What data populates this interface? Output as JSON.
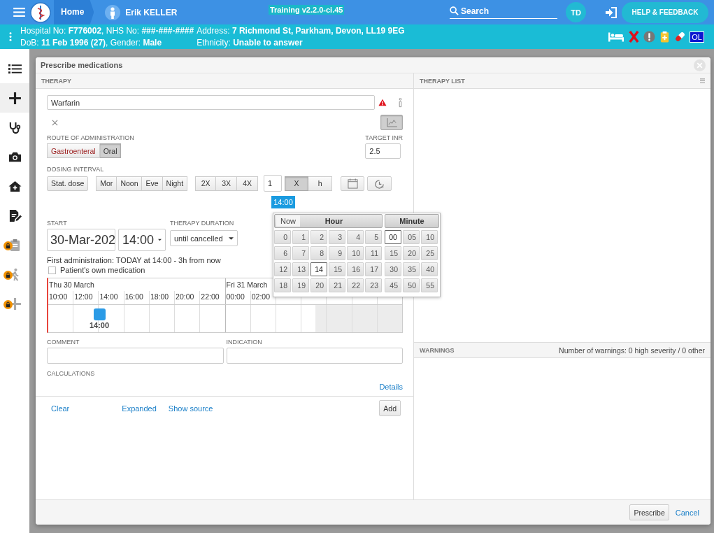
{
  "top_bar": {
    "home": "Home",
    "patient_name": "Erik KELLER",
    "version": "Training v2.2.0-ci.45",
    "search": {
      "placeholder": "Search"
    },
    "user_initials": "TD",
    "help_button": "HELP & FEEDBACK"
  },
  "patient_banner": {
    "lines": [
      "Hospital No: **F776002**, NHS No: **###-###-####**",
      "DoB: **11 Feb 1996 (27)**, Gender: **Male**"
    ],
    "address_lines": [
      "Address: **7 Richmond St, Parkham, Devon, LL19 9EG**",
      "Ethnicity: **Unable to answer**"
    ],
    "icons": [
      {
        "kind": "bed"
      },
      {
        "kind": "cross"
      },
      {
        "kind": "alert"
      },
      {
        "kind": "clipboard"
      },
      {
        "kind": "pill"
      },
      {
        "kind": "badge",
        "label": "OL"
      }
    ]
  },
  "sidebar": {
    "items": [
      {
        "kind": "list",
        "selected": false,
        "locked": false
      },
      {
        "kind": "plus",
        "selected": true,
        "locked": false
      },
      {
        "kind": "stethoscope",
        "selected": false,
        "locked": false
      },
      {
        "kind": "camera",
        "selected": false,
        "locked": false
      },
      {
        "kind": "house",
        "selected": false,
        "locked": false
      },
      {
        "kind": "document",
        "selected": false,
        "locked": false
      },
      {
        "kind": "clipboard",
        "selected": false,
        "locked": true
      },
      {
        "kind": "walker",
        "selected": false,
        "locked": true
      },
      {
        "kind": "plus",
        "selected": false,
        "locked": true
      }
    ]
  },
  "modal": {
    "title": "Prescribe medications",
    "therapy": {
      "header": "THERAPY",
      "medication": "Warfarin",
      "route": {
        "label": "ROUTE OF ADMINISTRATION",
        "options": [
          {
            "label": "Gastroenteral",
            "selected": false
          },
          {
            "label": "Oral",
            "selected": true
          }
        ]
      },
      "target_inr": {
        "label": "TARGET INR",
        "value": "2.5"
      },
      "dosing": {
        "label": "DOSING INTERVAL",
        "stat_dose": "Stat. dose",
        "times": [
          "Mor",
          "Noon",
          "Eve",
          "Night"
        ],
        "frequencies": [
          "2X",
          "3X",
          "4X"
        ],
        "count": "1",
        "units": [
          {
            "label": "X",
            "selected": true
          },
          {
            "label": "h",
            "selected": false
          }
        ],
        "time_tag": "14:00"
      },
      "start": {
        "label": "START",
        "date": "30-Mar-202",
        "time": "14:00"
      },
      "duration": {
        "label": "THERAPY DURATION",
        "value": "until cancelled"
      },
      "first_administration": "First administration: TODAY at 14:00 - 3h from now",
      "own_medication": {
        "label": "Patient's own medication",
        "checked": false
      },
      "timeline": {
        "days": [
          {
            "label": "Thu 30 March",
            "hours": [
              "10:00",
              "12:00",
              "14:00",
              "16:00",
              "18:00",
              "20:00",
              "22:00"
            ]
          },
          {
            "label": "Fri 31 March",
            "hours": [
              "00:00",
              "02:00"
            ]
          }
        ],
        "marker": "14:00"
      },
      "comment": {
        "label": "COMMENT"
      },
      "indication": {
        "label": "INDICATION"
      },
      "calculations": "CALCULATIONS",
      "details_link": "Details",
      "links": [
        "Clear",
        "Expanded",
        "Show source"
      ],
      "add_button": "Add"
    },
    "therapy_list": {
      "header": "THERAPY LIST"
    },
    "warnings": {
      "header": "WARNINGS",
      "summary": "Number of warnings: 0 high severity / 0 other"
    },
    "buttons": {
      "prescribe": "Prescribe",
      "cancel": "Cancel"
    }
  },
  "time_picker": {
    "now": "Now",
    "hour_header": "Hour",
    "minute_header": "Minute",
    "hours": [
      {
        "label": "0",
        "selected": false
      },
      {
        "label": "1",
        "selected": false
      },
      {
        "label": "2",
        "selected": false
      },
      {
        "label": "3",
        "selected": false
      },
      {
        "label": "4",
        "selected": false
      },
      {
        "label": "5",
        "selected": false
      },
      {
        "label": "6",
        "selected": false
      },
      {
        "label": "7",
        "selected": false
      },
      {
        "label": "8",
        "selected": false
      },
      {
        "label": "9",
        "selected": false
      },
      {
        "label": "10",
        "selected": false
      },
      {
        "label": "11",
        "selected": false
      },
      {
        "label": "12",
        "selected": false
      },
      {
        "label": "13",
        "selected": false
      },
      {
        "label": "14",
        "selected": true
      },
      {
        "label": "15",
        "selected": false
      },
      {
        "label": "16",
        "selected": false
      },
      {
        "label": "17",
        "selected": false
      },
      {
        "label": "18",
        "selected": false
      },
      {
        "label": "19",
        "selected": false
      },
      {
        "label": "20",
        "selected": false
      },
      {
        "label": "21",
        "selected": false
      },
      {
        "label": "22",
        "selected": false
      },
      {
        "label": "23",
        "selected": false
      }
    ],
    "minutes": [
      {
        "label": "00",
        "selected": true
      },
      {
        "label": "05",
        "selected": false
      },
      {
        "label": "10",
        "selected": false
      },
      {
        "label": "15",
        "selected": false
      },
      {
        "label": "20",
        "selected": false
      },
      {
        "label": "25",
        "selected": false
      },
      {
        "label": "30",
        "selected": false
      },
      {
        "label": "35",
        "selected": false
      },
      {
        "label": "40",
        "selected": false
      },
      {
        "label": "45",
        "selected": false
      },
      {
        "label": "50",
        "selected": false
      },
      {
        "label": "55",
        "selected": false
      }
    ]
  }
}
